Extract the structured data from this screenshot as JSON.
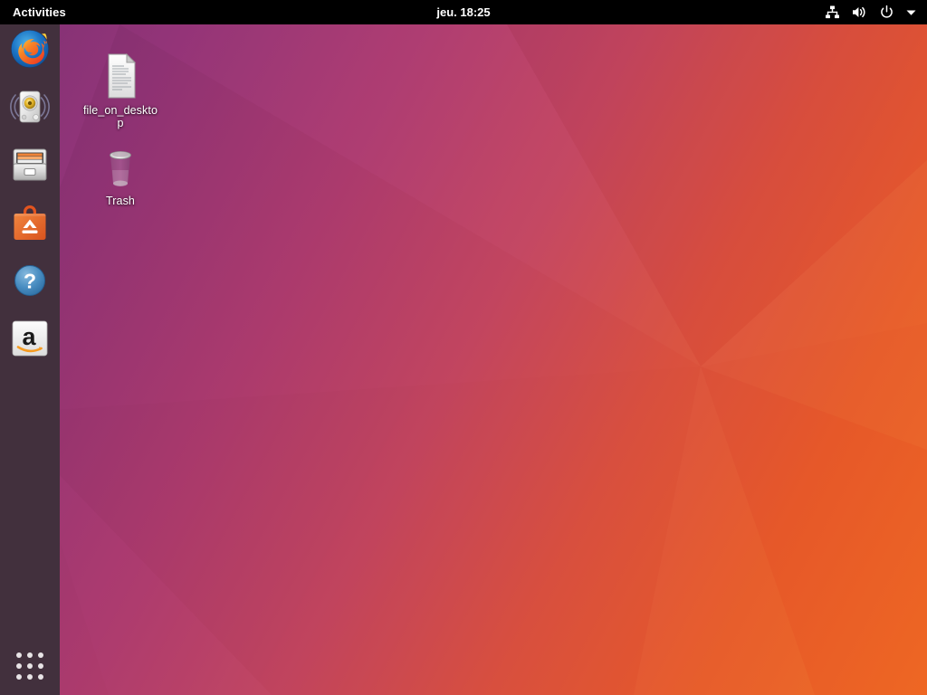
{
  "topbar": {
    "activities_label": "Activities",
    "clock": "jeu. 18:25",
    "tray": [
      {
        "name": "network-wired-icon",
        "label": "Network"
      },
      {
        "name": "volume-icon",
        "label": "Volume"
      },
      {
        "name": "power-icon",
        "label": "Power"
      },
      {
        "name": "chevron-down-icon",
        "label": "System menu"
      }
    ]
  },
  "dock": {
    "background_color": "#42303d",
    "items": [
      {
        "name": "firefox",
        "label": "Firefox Web Browser"
      },
      {
        "name": "rhythmbox",
        "label": "Rhythmbox"
      },
      {
        "name": "files",
        "label": "Files"
      },
      {
        "name": "ubuntu-software",
        "label": "Ubuntu Software"
      },
      {
        "name": "help",
        "label": "Help"
      },
      {
        "name": "amazon",
        "label": "Amazon"
      }
    ],
    "show_applications_label": "Show Applications"
  },
  "desktop": {
    "icons": [
      {
        "name": "file-on-desktop",
        "label": "file_on_desktop",
        "kind": "text-file"
      },
      {
        "name": "trash",
        "label": "Trash",
        "kind": "trash"
      }
    ],
    "wallpaper_colors": {
      "purple": "#7b2e6e",
      "magenta": "#a83a6a",
      "red_orange": "#d4503f",
      "orange": "#e95420"
    }
  }
}
